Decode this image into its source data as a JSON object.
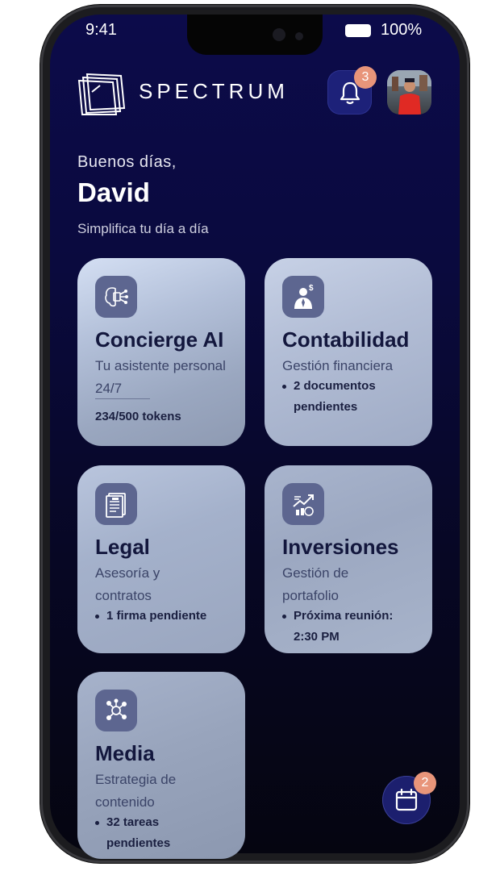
{
  "status_bar": {
    "time": "9:41",
    "battery": "100%"
  },
  "header": {
    "brand": "SPECTRUM",
    "notifications_count": "3"
  },
  "greeting": {
    "hello": "Buenos días,",
    "name": "David",
    "tagline": "Simplifica tu día a día"
  },
  "cards": [
    {
      "title": "Concierge AI",
      "subtitle": "Tu asistente personal 24/7",
      "meta": "234/500 tokens",
      "icon": "brain-chip-icon"
    },
    {
      "title": "Contabilidad",
      "subtitle": "Gestión financiera",
      "meta": "2 documentos pendientes",
      "icon": "accountant-icon"
    },
    {
      "title": "Legal",
      "subtitle": "Asesoría y contratos",
      "meta": "1 firma pendiente",
      "icon": "document-icon"
    },
    {
      "title": "Inversiones",
      "subtitle": "Gestión de portafolio",
      "meta": "Próxima reunión: 2:30 PM",
      "icon": "investment-icon"
    },
    {
      "title": "Media",
      "subtitle": "Estrategia de contenido",
      "meta": "32 tareas pendientes",
      "icon": "network-icon"
    }
  ],
  "calendar_fab": {
    "badge": "2",
    "icon": "calendar-icon"
  },
  "colors": {
    "accent_badge": "#e8957a",
    "background_top": "#0c0b4a",
    "card_title": "#13173d"
  }
}
